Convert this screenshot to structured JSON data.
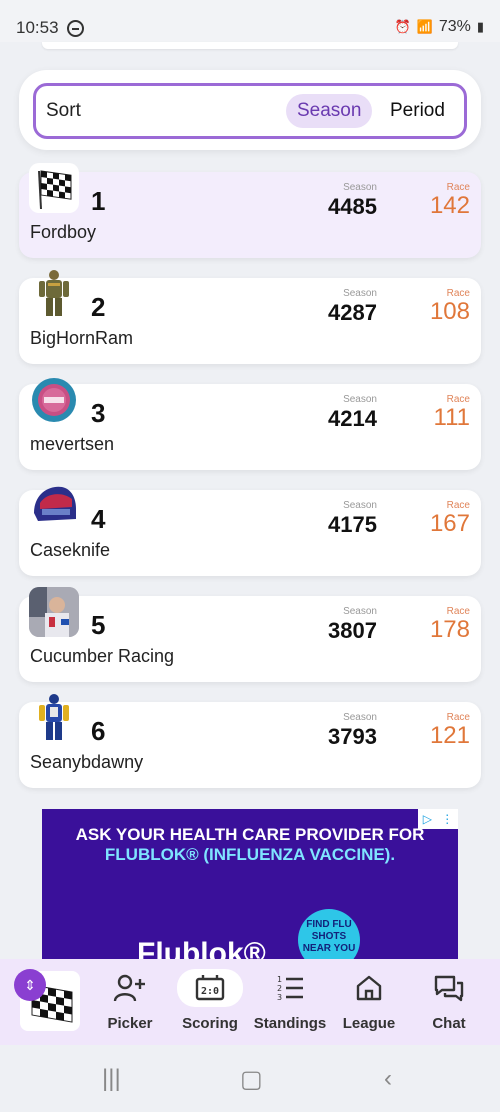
{
  "status_bar": {
    "time": "10:53",
    "battery": "73%"
  },
  "sort": {
    "label": "Sort",
    "options": [
      "Season",
      "Period"
    ],
    "selected": "Season"
  },
  "standings": {
    "season_label": "Season",
    "race_label": "Race",
    "rows": [
      {
        "rank": "1",
        "name": "Fordboy",
        "season": "4485",
        "race": "142",
        "avatar": "checkered-flag-icon"
      },
      {
        "rank": "2",
        "name": "BigHornRam",
        "season": "4287",
        "race": "108",
        "avatar": "driver-suit-icon"
      },
      {
        "rank": "3",
        "name": "mevertsen",
        "season": "4214",
        "race": "111",
        "avatar": "fantrax-gauge-icon"
      },
      {
        "rank": "4",
        "name": "Caseknife",
        "season": "4175",
        "race": "167",
        "avatar": "racing-helmet-icon"
      },
      {
        "rank": "5",
        "name": "Cucumber Racing",
        "season": "3807",
        "race": "178",
        "avatar": "driver-photo"
      },
      {
        "rank": "6",
        "name": "Seanybdawny",
        "season": "3793",
        "race": "121",
        "avatar": "driver-suit-icon"
      }
    ]
  },
  "ad": {
    "line1": "ASK YOUR HEALTH CARE PROVIDER FOR",
    "line2": "FLUBLOK® (INFLUENZA VACCINE).",
    "badge": "FIND FLU SHOTS NEAR YOU",
    "brand": "Flublok®"
  },
  "bottom_nav": {
    "items": [
      {
        "label": "Picker",
        "icon": "add-person-icon"
      },
      {
        "label": "Scoring",
        "icon": "scoreboard-icon"
      },
      {
        "label": "Standings",
        "icon": "ranked-list-icon"
      },
      {
        "label": "League",
        "icon": "home-icon"
      },
      {
        "label": "Chat",
        "icon": "chat-icon"
      }
    ],
    "active": "Scoring"
  },
  "colors": {
    "accent": "#9b6ad6",
    "race": "#e0773a",
    "nav_bg": "#f0e6fb"
  }
}
